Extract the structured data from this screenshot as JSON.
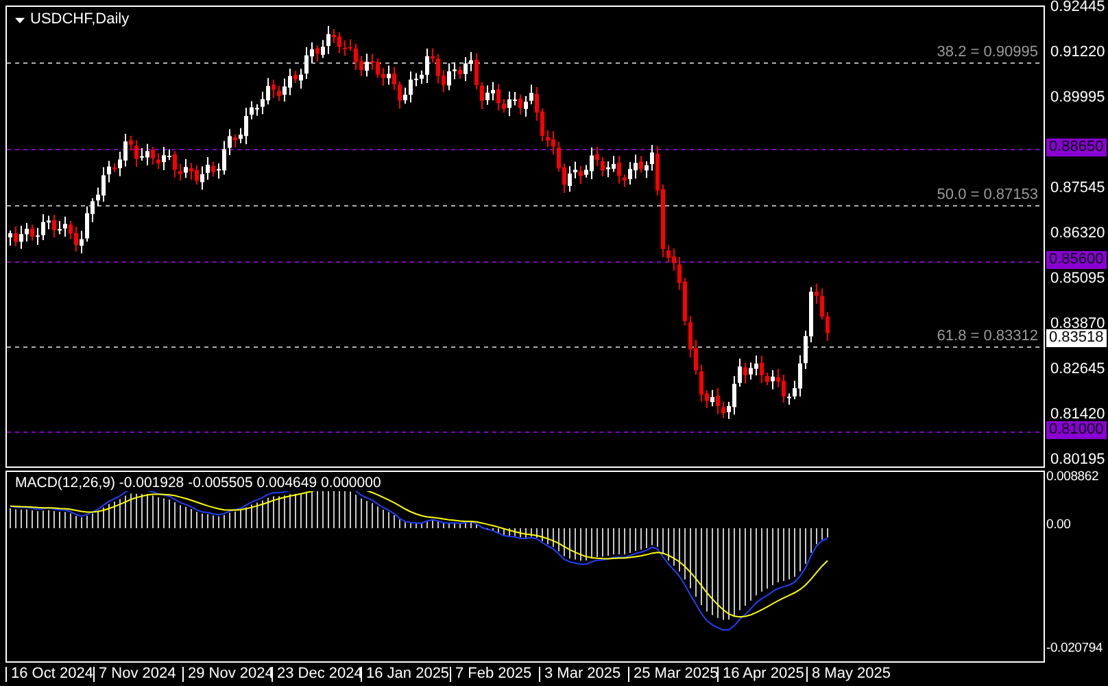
{
  "chart": {
    "title": "USDCHF,Daily",
    "price_axis": [
      "0.92445",
      "0.91220",
      "0.89995",
      "0.87545",
      "0.86320",
      "0.85095",
      "0.83870",
      "0.82645",
      "0.81420",
      "0.80195"
    ],
    "fib_levels": [
      {
        "label": "38.2 = 0.90995"
      },
      {
        "label": "50.0 = 0.87153"
      },
      {
        "label": "61.8 = 0.83312"
      }
    ],
    "price_tags": [
      {
        "text": "0.88650",
        "kind": "level"
      },
      {
        "text": "0.85600",
        "kind": "level"
      },
      {
        "text": "0.83518",
        "kind": "current"
      },
      {
        "text": "0.81000",
        "kind": "level"
      }
    ]
  },
  "macd": {
    "label": "MACD(12,26,9) -0.001928 -0.005505 0.004649 0.000000",
    "axis": [
      "0.008862",
      "0.00",
      "-0.020794"
    ]
  },
  "time_axis": [
    "16 Oct 2024",
    "7 Nov 2024",
    "29 Nov 2024",
    "23 Dec 2024",
    "16 Jan 2025",
    "7 Feb 2025",
    "3 Mar 2025",
    "25 Mar 2025",
    "16 Apr 2025",
    "8 May 2025"
  ]
}
